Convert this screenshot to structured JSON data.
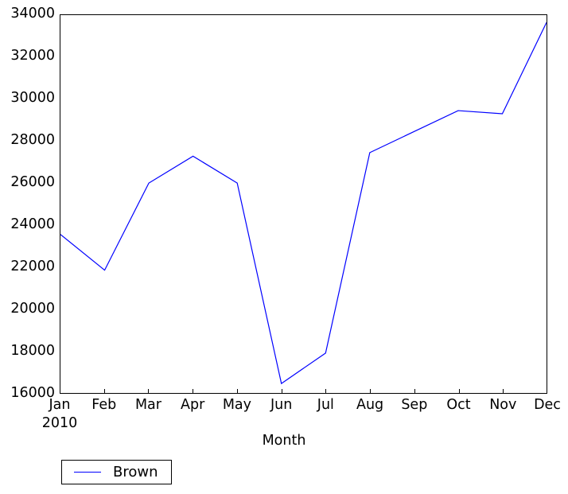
{
  "chart_data": {
    "type": "line",
    "title": "",
    "xlabel": "Month",
    "ylabel": "",
    "categories": [
      "Jan",
      "Feb",
      "Mar",
      "Apr",
      "May",
      "Jun",
      "Jul",
      "Aug",
      "Sep",
      "Oct",
      "Nov",
      "Dec"
    ],
    "x_subtick_label": "2010",
    "series": [
      {
        "name": "Brown",
        "color": "#0000ff",
        "values": [
          23550,
          21850,
          26000,
          27280,
          26000,
          16450,
          17900,
          27450,
          28450,
          29450,
          29300,
          33650
        ]
      }
    ],
    "ylim": [
      16000,
      34000
    ],
    "yticks": [
      16000,
      18000,
      20000,
      22000,
      24000,
      26000,
      28000,
      30000,
      32000,
      34000
    ],
    "ytick_labels": [
      "16000",
      "18000",
      "20000",
      "22000",
      "24000",
      "26000",
      "28000",
      "30000",
      "32000",
      "34000"
    ],
    "grid": false,
    "legend_position": "below-left",
    "legend_entries": [
      "Brown"
    ]
  },
  "axes": {
    "frame_color": "#000000",
    "background": "#ffffff"
  }
}
